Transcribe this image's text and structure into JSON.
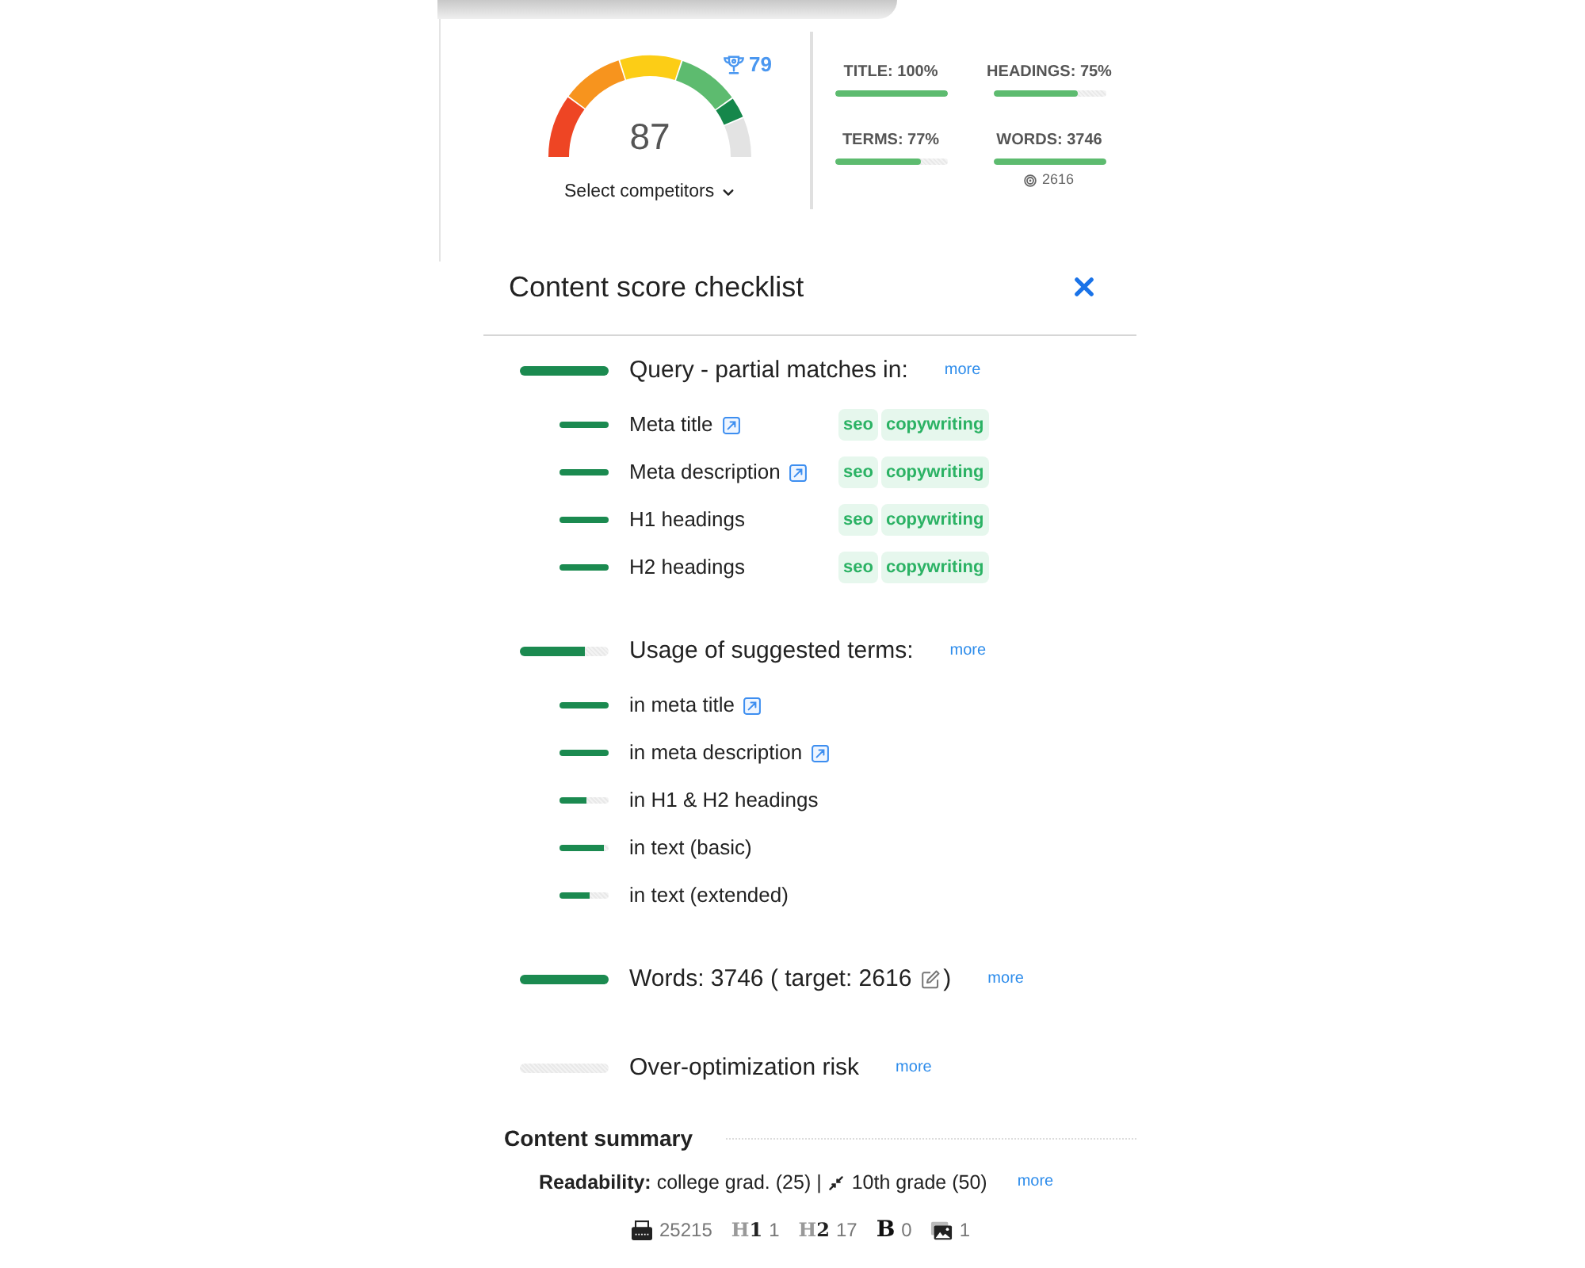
{
  "score_panel": {
    "gauge": {
      "score": "87"
    },
    "competitor": {
      "score": "79"
    },
    "select_competitors": "Select competitors",
    "metrics": [
      {
        "label": "TITLE: 100%",
        "level": 1
      },
      {
        "label": "HEADINGS: 75%",
        "level": 0.75
      },
      {
        "label": "TERMS: 77%",
        "level": 0.77
      },
      {
        "label": "WORDS: 3746",
        "level": 1,
        "target": "2616"
      }
    ]
  },
  "checklist": {
    "title": "Content score checklist",
    "sections": [
      {
        "label": "Query - partial matches in:",
        "level": 1,
        "more": "more",
        "children": [
          {
            "label": "Meta title",
            "level": 1,
            "link": true,
            "tags": [
              "seo",
              "copywriting"
            ]
          },
          {
            "label": "Meta description",
            "level": 1,
            "link": true,
            "tags": [
              "seo",
              "copywriting"
            ]
          },
          {
            "label": "H1 headings",
            "level": 1,
            "link": false,
            "tags": [
              "seo",
              "copywriting"
            ]
          },
          {
            "label": "H2 headings",
            "level": 1,
            "link": false,
            "tags": [
              "seo",
              "copywriting"
            ]
          }
        ]
      },
      {
        "label": "Usage of suggested terms:",
        "level": 0.74,
        "more": "more",
        "children": [
          {
            "label": "in meta title",
            "level": 1,
            "link": true
          },
          {
            "label": "in meta description",
            "level": 1,
            "link": true
          },
          {
            "label": "in H1 & H2 headings",
            "level": 0.55,
            "link": false
          },
          {
            "label": "in text (basic)",
            "level": 0.89,
            "link": false
          },
          {
            "label": "in text (extended)",
            "level": 0.61,
            "link": false
          }
        ]
      },
      {
        "label": "Words: 3746 ( target: 2616",
        "editable": true,
        "label_end": ")",
        "level": 1,
        "more": "more"
      },
      {
        "label": "Over-optimization risk",
        "level": 0,
        "more": "more"
      }
    ]
  },
  "content_summary": {
    "title": "Content summary",
    "readability": {
      "text": "**Readability:** college grad. (25) |",
      "target": "10th grade (50)",
      "more": "more"
    },
    "stats": [
      {
        "kind": "pages",
        "value": "25215"
      },
      {
        "kind": "heading",
        "symbol": "H**1**",
        "value": "1"
      },
      {
        "kind": "heading",
        "symbol": "H**2**",
        "value": "17"
      },
      {
        "kind": "bold",
        "symbol": "B",
        "value": "0"
      },
      {
        "kind": "images",
        "value": "1"
      }
    ]
  }
}
